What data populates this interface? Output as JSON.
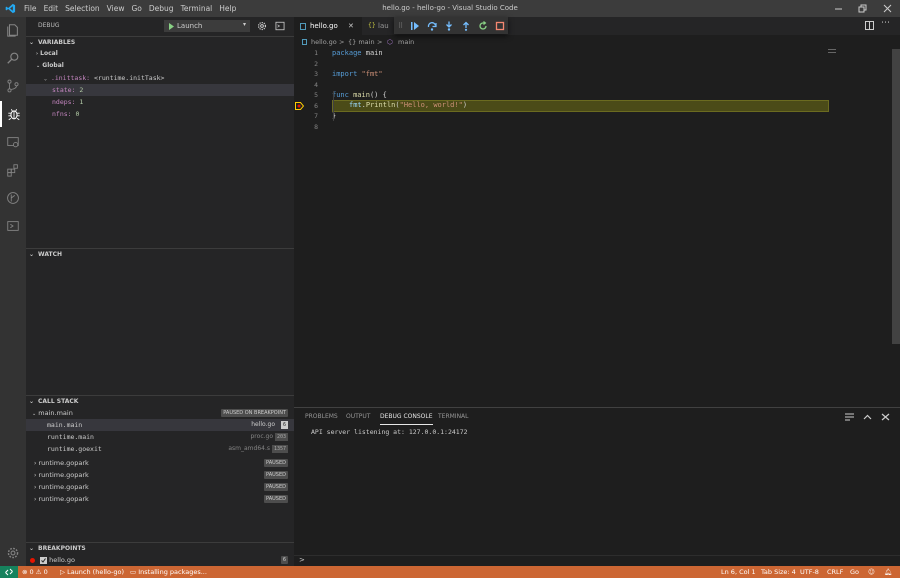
{
  "window": {
    "title": "hello.go - hello-go - Visual Studio Code"
  },
  "menu": [
    "File",
    "Edit",
    "Selection",
    "View",
    "Go",
    "Debug",
    "Terminal",
    "Help"
  ],
  "debug_header": {
    "label": "DEBUG",
    "config": "Launch"
  },
  "variables": {
    "title": "VARIABLES",
    "local": "Local",
    "global": "Global",
    "inittask_name": ".inittask:",
    "inittask_value": "<runtime.initTask>",
    "fields": [
      {
        "name": "state:",
        "value": "2"
      },
      {
        "name": "ndeps:",
        "value": "1"
      },
      {
        "name": "nfns:",
        "value": "0"
      }
    ]
  },
  "watch": {
    "title": "WATCH"
  },
  "callstack": {
    "title": "CALL STACK",
    "thread": "main.main",
    "thread_status": "PAUSED ON BREAKPOINT",
    "frames": [
      {
        "name": "main.main",
        "file": "hello.go",
        "line": "6"
      },
      {
        "name": "runtime.main",
        "file": "proc.go",
        "line": "203"
      },
      {
        "name": "runtime.goexit",
        "file": "asm_amd64.s",
        "line": "1357"
      }
    ],
    "goroutines": [
      {
        "name": "runtime.gopark",
        "status": "PAUSED"
      },
      {
        "name": "runtime.gopark",
        "status": "PAUSED"
      },
      {
        "name": "runtime.gopark",
        "status": "PAUSED"
      },
      {
        "name": "runtime.gopark",
        "status": "PAUSED"
      }
    ]
  },
  "breakpoints": {
    "title": "BREAKPOINTS",
    "item": "hello.go",
    "count": "6"
  },
  "tabs": [
    {
      "label": "hello.go",
      "active": true
    },
    {
      "label": "lau",
      "active": false
    }
  ],
  "breadcrumb": {
    "file": "hello.go",
    "sep1": ">",
    "pkg": "{} main",
    "sep2": ">",
    "func": "main"
  },
  "code_lines": [
    {
      "n": "1"
    },
    {
      "n": "2"
    },
    {
      "n": "3"
    },
    {
      "n": "4"
    },
    {
      "n": "5"
    },
    {
      "n": "6"
    },
    {
      "n": "7"
    },
    {
      "n": "8"
    }
  ],
  "code": {
    "l1_kw": "package",
    "l1_id": " main",
    "l3_kw": "import",
    "l3_str": " \"fmt\"",
    "l5_kw": "func",
    "l5_fn": " main",
    "l5_rest": "() {",
    "l6_id": "fmt",
    "l6_dot": ".",
    "l6_fn": "Println",
    "l6_p1": "(",
    "l6_str": "\"Hello, world!\"",
    "l6_p2": ")",
    "l7": "}"
  },
  "panel": {
    "tabs": [
      "PROBLEMS",
      "OUTPUT",
      "DEBUG CONSOLE",
      "TERMINAL"
    ],
    "output": "API server listening at: 127.0.0.1:24172",
    "prompt": ">"
  },
  "status": {
    "errors": "0",
    "warnings": "0",
    "launch": "Launch (hello-go)",
    "installing": "Installing packages...",
    "position": "Ln 6, Col 1",
    "tabsize": "Tab Size: 4",
    "encoding": "UTF-8",
    "eol": "CRLF",
    "language": "Go"
  },
  "colors": {
    "statusbar": "#cc6633",
    "accent": "#007acc",
    "breakpoint": "#e51400"
  }
}
